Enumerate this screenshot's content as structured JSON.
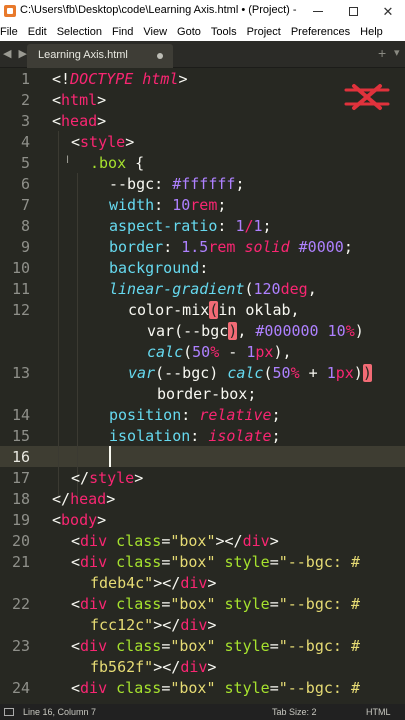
{
  "window": {
    "title": "C:\\Users\\fb\\Desktop\\code\\Learning Axis.html • (Project) - Su...",
    "minimize_glyph": "—",
    "maximize_glyph": "☐",
    "close_glyph": "✕"
  },
  "menu": [
    "File",
    "Edit",
    "Selection",
    "Find",
    "View",
    "Goto",
    "Tools",
    "Project",
    "Preferences",
    "Help"
  ],
  "tabs": {
    "nav_arrows": "◀ ▶",
    "active_label": "Learning Axis.html",
    "new_tab_glyph": "+",
    "dropdown_glyph": "▾"
  },
  "line_numbers": [
    "1",
    "2",
    "3",
    "4",
    "5",
    "6",
    "7",
    "8",
    "9",
    "10",
    "11",
    "12",
    "13",
    "14",
    "15",
    "16",
    "17",
    "18",
    "19",
    "20",
    "21",
    "22",
    "23",
    "24"
  ],
  "code": {
    "l1a": "<!",
    "l1b": "DOCTYPE",
    "l1c": " html",
    "l1d": ">",
    "l2a": "<",
    "l2b": "html",
    "l2c": ">",
    "l3a": "<",
    "l3b": "head",
    "l3c": ">",
    "l4a": "<",
    "l4b": "style",
    "l4c": ">",
    "l5a": ".box",
    "l5b": " {",
    "l6a": "--bgc",
    "l6b": ": ",
    "l6c": "#ffffff",
    "l6d": ";",
    "l7a": "width",
    "l7b": ": ",
    "l7c": "10",
    "l7d": "rem",
    "l7e": ";",
    "l8a": "aspect-ratio",
    "l8b": ": ",
    "l8c": "1",
    "l8d": "/",
    "l8e": "1",
    "l8f": ";",
    "l9a": "border",
    "l9b": ": ",
    "l9c": "1.5",
    "l9d": "rem",
    "l9e": " ",
    "l9f": "solid",
    "l9g": " ",
    "l9h": "#0000",
    "l9i": ";",
    "l10a": "background",
    "l10b": ":",
    "l11a": "linear-gradient",
    "l11b": "(",
    "l11c": "120",
    "l11d": "deg",
    "l11e": ",",
    "l12a": "color-mix",
    "l12b": "(",
    "l12c": "in oklab,",
    "l12d": "var",
    "l12e": "(--bgc",
    "l12f": ")",
    "l12g": ", ",
    "l12h": "#000000",
    "l12i": " ",
    "l12j": "10",
    "l12k": "%",
    "l12l": ")",
    "l12m": "calc",
    "l12n": "(",
    "l12o": "50",
    "l12p": "%",
    "l12q": " - ",
    "l12r": "1",
    "l12s": "px",
    "l12t": "),",
    "l13a": "var",
    "l13b": "(--bgc) ",
    "l13c": "calc",
    "l13d": "(",
    "l13e": "50",
    "l13f": "%",
    "l13g": " + ",
    "l13h": "1",
    "l13i": "px",
    "l13j": ")",
    "l13k": ")",
    "l13l": "border-box",
    "l13m": ";",
    "l14a": "position",
    "l14b": ": ",
    "l14c": "relative",
    "l14d": ";",
    "l15a": "isolation",
    "l15b": ": ",
    "l15c": "isolate",
    "l15d": ";",
    "l17a": "</",
    "l17b": "style",
    "l17c": ">",
    "l18a": "</",
    "l18b": "head",
    "l18c": ">",
    "l19a": "<",
    "l19b": "body",
    "l19c": ">",
    "l20a": "<",
    "l20b": "div",
    "l20c": " class",
    "l20d": "=",
    "l20e": "\"box\"",
    "l20f": "></",
    "l20g": "div",
    "l20h": ">",
    "l21a": "<",
    "l21b": "div",
    "l21c": " class",
    "l21d": "=",
    "l21e": "\"box\"",
    "l21f": " style",
    "l21g": "=",
    "l21h": "\"--bgc: #",
    "l21i": "fdeb4c\"",
    "l21j": "></",
    "l21k": "div",
    "l21l": ">",
    "l22a": "<",
    "l22b": "div",
    "l22c": " class",
    "l22d": "=",
    "l22e": "\"box\"",
    "l22f": " style",
    "l22g": "=",
    "l22h": "\"--bgc: #",
    "l22i": "fcc12c\"",
    "l22j": "></",
    "l22k": "div",
    "l22l": ">",
    "l23a": "<",
    "l23b": "div",
    "l23c": " class",
    "l23d": "=",
    "l23e": "\"box\"",
    "l23f": " style",
    "l23g": "=",
    "l23h": "\"--bgc: #",
    "l23i": "fb562f\"",
    "l23j": "></",
    "l23k": "div",
    "l23l": ">",
    "l24a": "<",
    "l24b": "div",
    "l24c": " class",
    "l24d": "=",
    "l24e": "\"box\"",
    "l24f": " style",
    "l24g": "=",
    "l24h": "\"--bgc: #"
  },
  "status": {
    "position": "Line 16, Column 7",
    "tab_size": "Tab Size: 2",
    "syntax": "HTML"
  },
  "colors": {
    "editor_bg": "#272822",
    "tag": "#f92672",
    "attribute": "#a6e22e",
    "string": "#e6db74",
    "number": "#ae81ff",
    "function": "#66d9ef",
    "bracket_highlight": "#f26b75",
    "logo": "#e0323c"
  },
  "icons": {
    "app": "sublime-text-icon",
    "logo": "crossed-x-logo-icon",
    "status_panel": "panel-toggle-icon"
  }
}
